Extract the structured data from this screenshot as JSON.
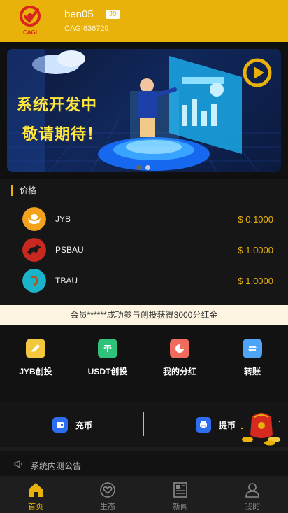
{
  "user": {
    "name": "ben05",
    "level": "J0",
    "id": "CAGI636729",
    "logo_text": "CAGI"
  },
  "banner": {
    "line1": "系统开发中",
    "line2": "敬请期待！",
    "slide_count": 2,
    "active_slide": 2
  },
  "prices": {
    "title": "价格",
    "items": [
      {
        "name": "JYB",
        "price": "$ 0.1000",
        "icon": "jyb-ingot-icon"
      },
      {
        "name": "PSBAU",
        "price": "$ 1.0000",
        "icon": "psbau-horse-icon"
      },
      {
        "name": "TBAU",
        "price": "$ 1.0000",
        "icon": "tbau-icon"
      }
    ]
  },
  "notice_strip": "会员******成功参与创投获得3000分红金",
  "menu": {
    "items": [
      {
        "label": "JYB创投",
        "icon": "edit-icon",
        "color": "#f3c83c"
      },
      {
        "label": "USDT创投",
        "icon": "tether-icon",
        "color": "#2fc27a"
      },
      {
        "label": "我的分红",
        "icon": "pie-chart-icon",
        "color": "#f06b5b"
      },
      {
        "label": "转账",
        "icon": "transfer-icon",
        "color": "#4ea4f6"
      }
    ]
  },
  "actions": {
    "deposit": "充币",
    "withdraw": "提币"
  },
  "announcement": "系统内测公告",
  "tabbar": {
    "items": [
      {
        "label": "首页",
        "icon": "home-icon"
      },
      {
        "label": "生态",
        "icon": "heart-icon"
      },
      {
        "label": "新闻",
        "icon": "news-icon"
      },
      {
        "label": "我的",
        "icon": "user-icon"
      }
    ],
    "active": "首页"
  },
  "colors": {
    "accent": "#e9b20a",
    "background": "#1b1b1b",
    "notice_bg": "#fdf5e1"
  }
}
